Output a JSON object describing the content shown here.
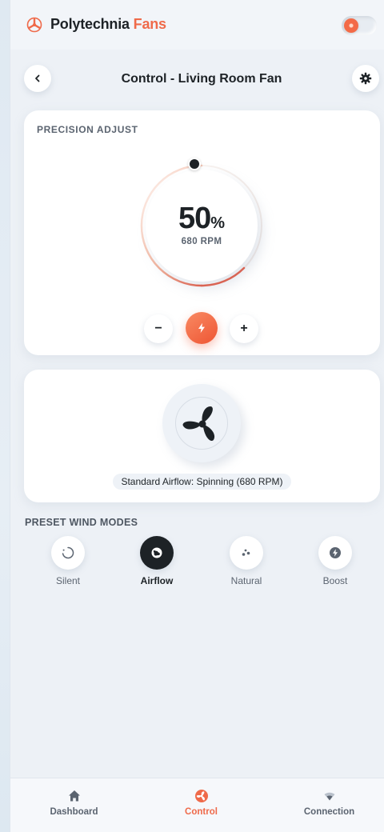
{
  "header": {
    "brand_main": "Polytechnia",
    "brand_accent": "Fans",
    "accent_color": "#ef6a4a",
    "toggle_on": true
  },
  "title_row": {
    "back_icon": "chevron-left-icon",
    "title": "Control - Living Room Fan",
    "settings_icon": "gear-icon"
  },
  "precision": {
    "label": "PRECISION ADJUST",
    "value": "50",
    "unit": "%",
    "speed_fraction": 0.5,
    "rpm": "680 RPM",
    "minus_label": "−",
    "plus_label": "+",
    "power_icon": "bolt-icon"
  },
  "visual": {
    "status": "Standard Airflow: Spinning (680 RPM)",
    "fan_icon": "fan-blades-icon"
  },
  "presets": {
    "label": "PRESET WIND MODES",
    "items": [
      {
        "label": "Silent",
        "icon": "spinner-icon",
        "active": false
      },
      {
        "label": "Airflow",
        "icon": "globe-icon",
        "active": true
      },
      {
        "label": "Natural",
        "icon": "dots-icon",
        "active": false
      },
      {
        "label": "Boost",
        "icon": "bolt-circle-icon",
        "active": false
      }
    ]
  },
  "nav": {
    "items": [
      {
        "label": "Dashboard",
        "icon": "home-icon",
        "active": false
      },
      {
        "label": "Control",
        "icon": "fan-circle-icon",
        "active": true
      },
      {
        "label": "Connection",
        "icon": "wifi-icon",
        "active": false
      }
    ]
  }
}
